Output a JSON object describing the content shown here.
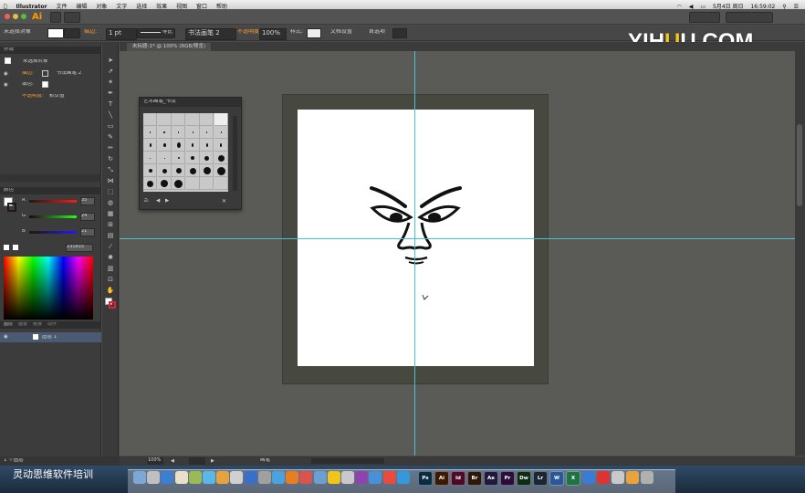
{
  "menubar": {
    "app": "Illustrator",
    "items": [
      "文件",
      "编辑",
      "对象",
      "文字",
      "选择",
      "效果",
      "视图",
      "窗口",
      "帮助"
    ],
    "date": "5月4日 周日",
    "time": "16:59:02"
  },
  "appbar": {
    "logo": "Ai"
  },
  "controlbar": {
    "selection": "未选择对象",
    "stroke_label": "描边:",
    "stroke_weight": "1 pt",
    "profile": "等比",
    "brush": "书法画笔 2",
    "opacity_label": "不透明度",
    "opacity_value": "100%",
    "style_label": "样式:",
    "doc_setup": "文档设置",
    "prefs": "首选项"
  },
  "watermark": {
    "a": "YI",
    "b": "H",
    "c": "U",
    "d": "U",
    "e": ".COM"
  },
  "document": {
    "tab": "未标题-1* @ 100% (RGB/预览)"
  },
  "appearance": {
    "title": "外观",
    "object": "未选择对象",
    "stroke_label": "描边:",
    "stroke_value": "书法画笔 2",
    "fill_label": "填色:",
    "opacity_label": "不透明度:",
    "opacity_value": "默认值"
  },
  "color_panel": {
    "title": "颜色",
    "r_label": "R",
    "g_label": "G",
    "b_label": "B",
    "r": "35",
    "g": "24",
    "b": "21",
    "hex": "231815"
  },
  "layers": {
    "tabs": [
      "图层",
      "画板",
      "链接",
      "动作"
    ],
    "layer_name": "图层 1",
    "count": "1 个图层"
  },
  "brushes_panel": {
    "title": "艺术画笔_书法"
  },
  "statusbar": {
    "zoom": "100%",
    "tool": "画笔"
  },
  "bottom_watermark": "灵动思维软件培训",
  "dock_apps": [
    "Ps",
    "Ai",
    "Id",
    "Br",
    "Ae",
    "Pr",
    "Dw",
    "Lr",
    "W",
    "X"
  ],
  "colors": {
    "accent": "#ff9a2f",
    "guide": "#49c2cf",
    "canvas": "#5a5a56"
  }
}
